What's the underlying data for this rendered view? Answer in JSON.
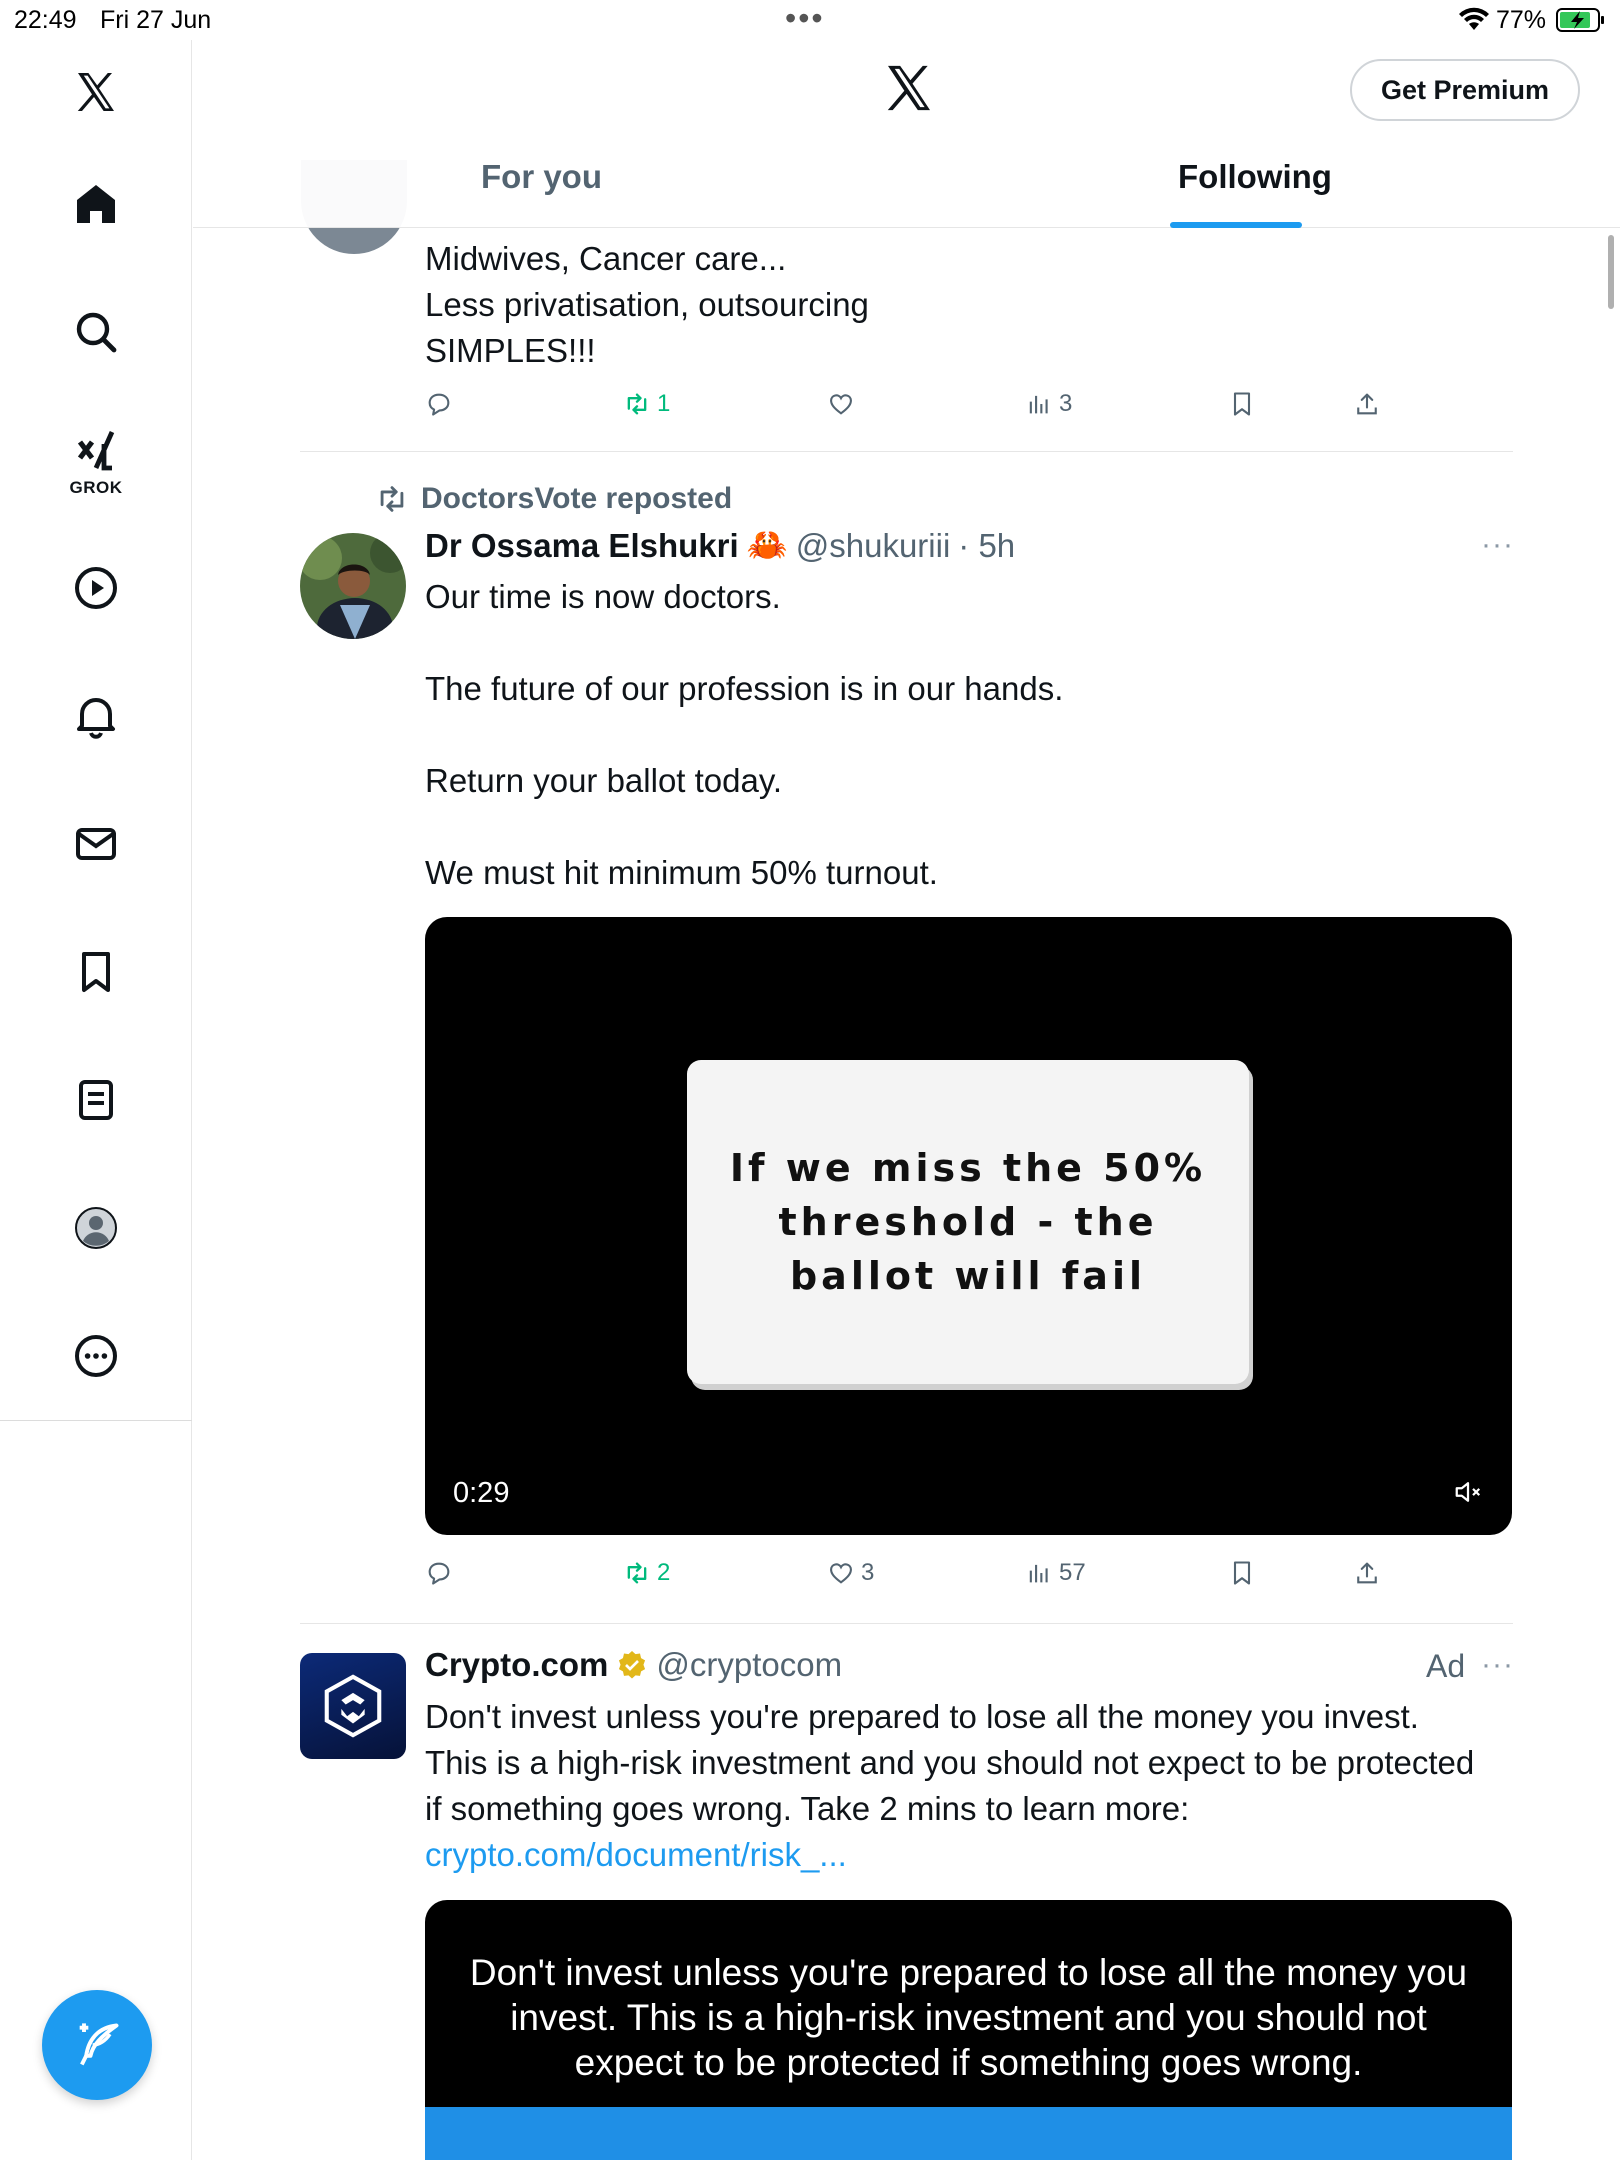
{
  "status_bar": {
    "time": "22:49",
    "date": "Fri 27 Jun",
    "battery": "77%"
  },
  "sidebar": {
    "items": [
      {
        "icon": "x-logo-icon"
      },
      {
        "icon": "home-icon"
      },
      {
        "icon": "search-icon"
      },
      {
        "icon": "grok-icon",
        "label": "GROK"
      },
      {
        "icon": "video-play-icon"
      },
      {
        "icon": "bell-icon"
      },
      {
        "icon": "mail-icon"
      },
      {
        "icon": "bookmark-icon"
      },
      {
        "icon": "lists-icon"
      },
      {
        "icon": "profile-icon"
      },
      {
        "icon": "more-circle-icon"
      }
    ],
    "compose_icon": "compose-post-icon"
  },
  "header": {
    "premium_label": "Get Premium",
    "tabs": [
      {
        "label": "For you",
        "active": false
      },
      {
        "label": "Following",
        "active": true
      }
    ]
  },
  "tweets": [
    {
      "text_lines": [
        "Midwives, Cancer care...",
        "Less privatisation, outsourcing",
        "SIMPLES!!!"
      ],
      "actions": {
        "reposts": "1",
        "views": "3"
      }
    },
    {
      "repost_by": "DoctorsVote reposted",
      "name": "Dr Ossama Elshukri",
      "emoji": "🦀",
      "handle": "@shukuriii",
      "time": "· 5h",
      "more": "···",
      "paragraphs": [
        "Our time is now doctors.",
        "The future of our profession is in our hands.",
        "Return your ballot today.",
        "We must hit minimum 50% turnout."
      ],
      "video": {
        "card_text": "If we miss the 50%\nthreshold - the\nballot will fail",
        "duration": "0:29"
      },
      "actions": {
        "reposts": "2",
        "likes": "3",
        "views": "57"
      }
    },
    {
      "name": "Crypto.com",
      "handle": "@cryptocom",
      "ad_label": "Ad",
      "more": "···",
      "text": "Don't invest unless you're prepared to lose all the money you invest. This is a high-risk investment and you should not expect to be protected if something goes wrong. Take 2 mins to learn more:",
      "link": "crypto.com/document/risk_...",
      "media_text": "Don't invest unless you're prepared to lose all the money you invest. This is a high-risk investment and you should not expect to be protected if something goes wrong."
    }
  ],
  "colors": {
    "accent": "#1d9bf0",
    "repost_green": "#00ba7c",
    "secondary_text": "#536471"
  }
}
